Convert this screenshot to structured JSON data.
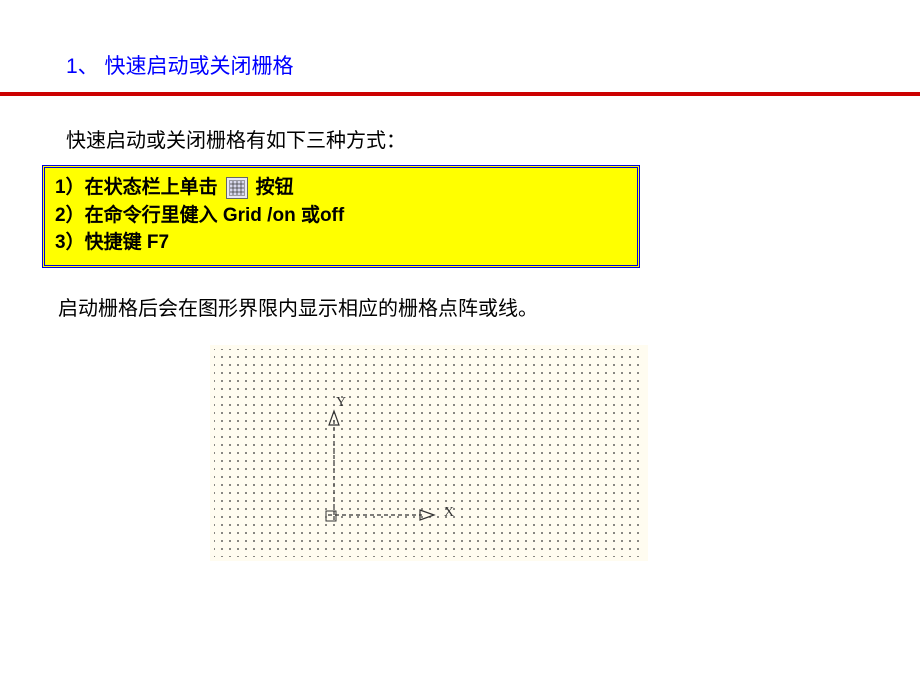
{
  "heading": "1、 快速启动或关闭栅格",
  "intro": "快速启动或关闭栅格有如下三种方式：",
  "box": {
    "line1_pre": "1）在状态栏上单击",
    "line1_post": "按钮",
    "line2": "2）在命令行里健入  Grid /on 或off",
    "line3": "3）快捷键 F7"
  },
  "after": "启动栅格后会在图形界限内显示相应的栅格点阵或线。",
  "axis": {
    "y": "Y",
    "x": "X"
  },
  "icon_names": {
    "grid_button": "grid-button-icon"
  }
}
